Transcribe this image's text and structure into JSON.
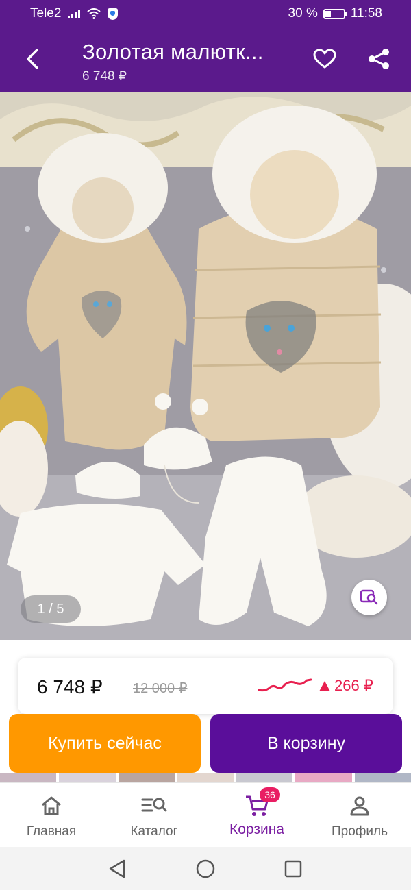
{
  "status_bar": {
    "carrier": "Tele2",
    "battery_percent": "30 %",
    "time": "11:58",
    "battery_level": 0.3
  },
  "header": {
    "title": "Золотая малютк...",
    "subtitle_price": "6 748 ₽",
    "back_icon": "back-arrow-icon",
    "favorite_icon": "heart-icon",
    "share_icon": "share-icon",
    "background_color": "#5b1a8c"
  },
  "gallery": {
    "counter": "1 / 5",
    "visual_search_icon": "image-search-icon"
  },
  "price_card": {
    "current_price": "6 748 ₽",
    "old_price": "12 000 ₽",
    "change": "266 ₽",
    "change_direction": "up",
    "change_color": "#e8204f"
  },
  "actions": {
    "buy_now": "Купить сейчас",
    "add_to_cart": "В корзину",
    "buy_color": "#ff9800",
    "cart_color": "#5a0e9a"
  },
  "bottom_nav": {
    "items": [
      {
        "label": "Главная",
        "icon": "home-icon"
      },
      {
        "label": "Каталог",
        "icon": "catalog-search-icon"
      },
      {
        "label": "Корзина",
        "icon": "cart-icon",
        "badge": "36",
        "active": true
      },
      {
        "label": "Профиль",
        "icon": "profile-icon"
      }
    ],
    "active_color": "#7b1fa2"
  },
  "system_nav": {
    "back": "triangle-back-icon",
    "home": "circle-home-icon",
    "recents": "square-recents-icon"
  }
}
